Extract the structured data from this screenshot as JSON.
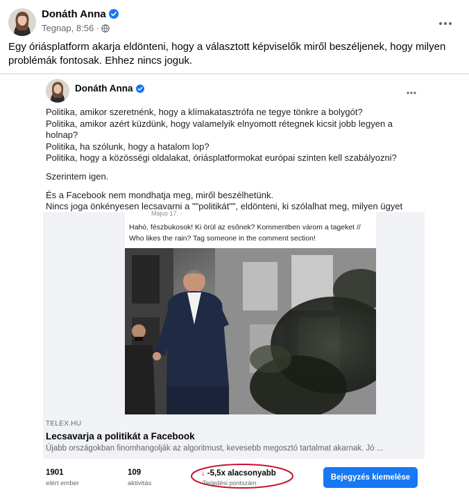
{
  "post": {
    "author": "Donáth Anna",
    "time": "Tegnap, 8:56 ·",
    "text": "Egy óriásplatform akarja eldönteni, hogy a választott képviselők miről beszéljenek, hogy milyen problémák fontosak. Ehhez nincs joguk."
  },
  "embedded": {
    "author": "Donáth Anna",
    "lines": [
      "Politika, amikor szeretnénk, hogy a klímakatasztrófa ne tegye tönkre a bolygót?",
      "Politika, amikor azért küzdünk, hogy valamelyik elnyomott rétegnek kicsit jobb legyen a holnap?",
      "Politika, ha szólunk, hogy a hatalom lop?",
      "Politika, hogy a közösségi oldalakat, óriásplatformokat európai szinten kell szabályozni?"
    ],
    "opinion": "Szerintem igen.",
    "para": "És a Facebook nem mondhatja meg, miről beszélhetünk.\nNincs joga önkényesen lecsavarni a \"\"politikát\"\", eldönteni, ki szólalhat meg, milyen ügyet karolhatunk fel, kiken segíthetünk. Ehelyett az álhírek lecsavarásában lehetnének ennyire buzgók.",
    "quoted_date": "Május 17. ·",
    "quoted_text": "Hahó, fészbukosok! Ki örül az esőnek? Kommentben várom a tageket // Who likes the rain? Tag someone in the comment section!",
    "link": {
      "domain": "TELEX.HU",
      "title": "Lecsavarja a politikát a Facebook",
      "description": "Újabb országokban finomhangolják az algoritmust, kevesebb megosztó tartalmat akarnak. Jó ..."
    },
    "stats": {
      "reach_value": "1901",
      "reach_label": "elért ember",
      "engagement_value": "109",
      "engagement_label": "aktivitás",
      "score_value": "-5,5x alacsonyabb",
      "score_label": "Terjedési pontszám",
      "boost_label": "Bejegyzés kiemelése"
    }
  },
  "colors": {
    "accent": "#1877f2",
    "highlight_oval": "#c8102e",
    "down_arrow": "#e41e3f"
  },
  "icons": [
    "verified-badge-icon",
    "globe-icon",
    "more-options-icon",
    "down-arrow-icon"
  ]
}
